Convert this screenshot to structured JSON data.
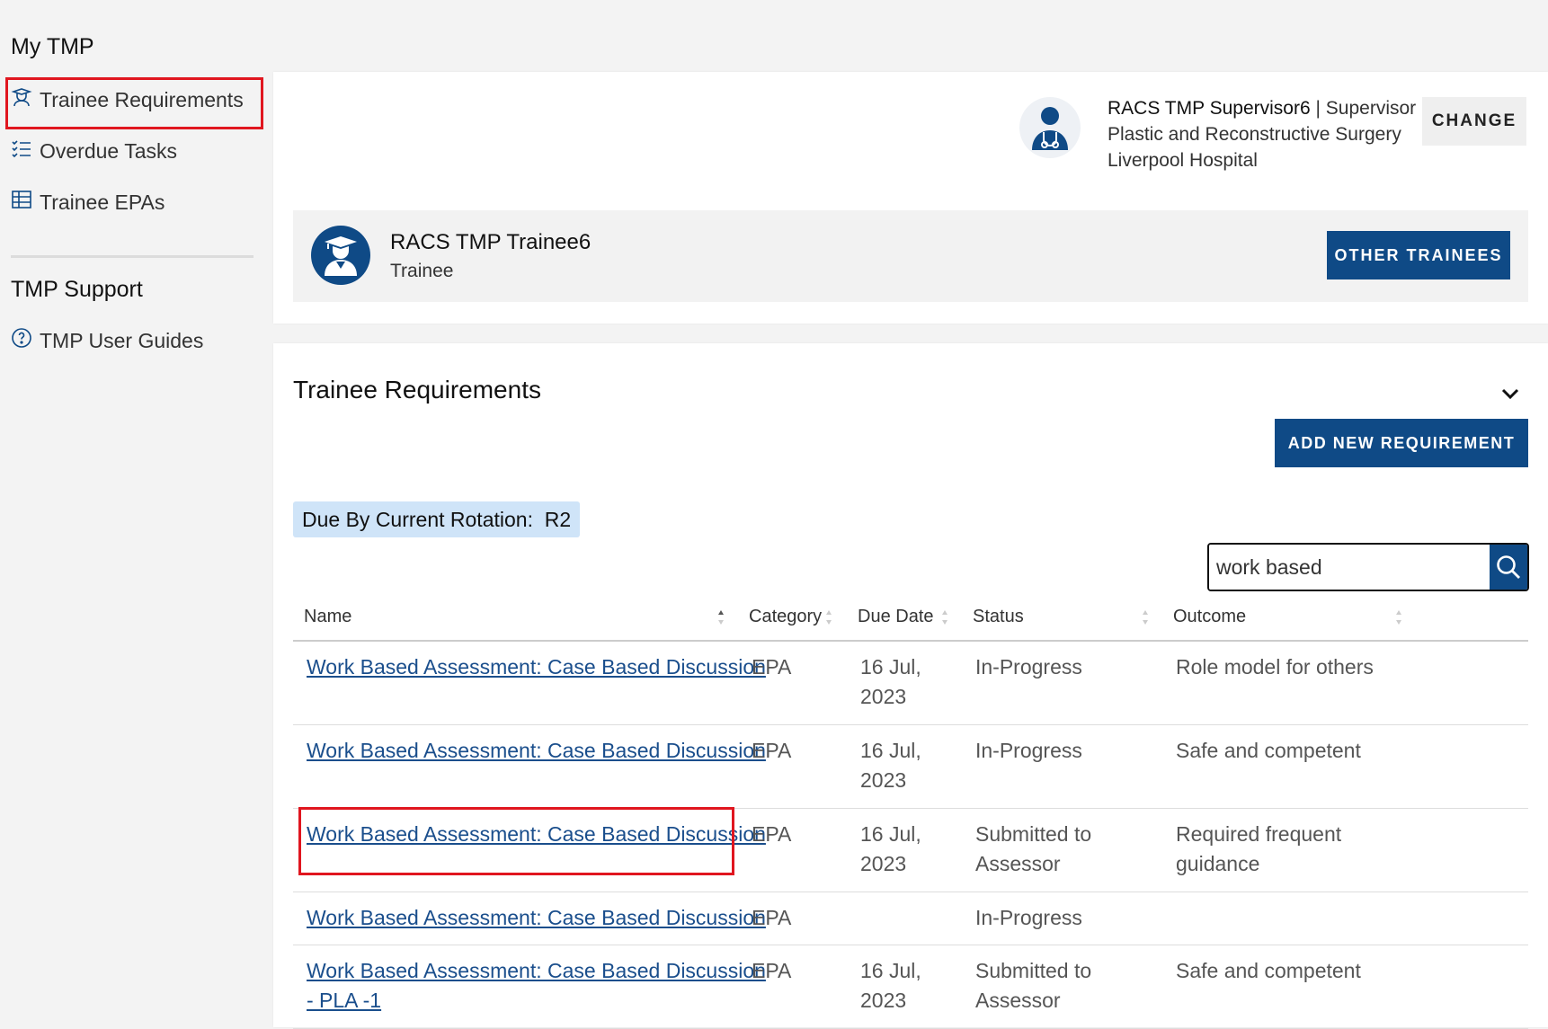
{
  "sidebar": {
    "section1_title": "My TMP",
    "items": [
      {
        "label": "Trainee Requirements",
        "icon": "mortarboard-person-icon"
      },
      {
        "label": "Overdue Tasks",
        "icon": "checklist-icon"
      },
      {
        "label": "Trainee EPAs",
        "icon": "table-icon"
      }
    ],
    "section2_title": "TMP Support",
    "support_items": [
      {
        "label": "TMP User Guides",
        "icon": "help-circle-icon"
      }
    ]
  },
  "supervisor": {
    "name": "RACS TMP Supervisor6",
    "separator": "|",
    "role": "Supervisor",
    "specialty": "Plastic and Reconstructive Surgery",
    "hospital": "Liverpool Hospital",
    "change_label": "CHANGE"
  },
  "trainee": {
    "name": "RACS TMP Trainee6",
    "role": "Trainee",
    "other_label": "OTHER TRAINEES"
  },
  "requirements": {
    "title": "Trainee Requirements",
    "add_label": "ADD NEW REQUIREMENT",
    "due_label": "Due By Current Rotation:",
    "due_value": "R2",
    "search_value": "work based",
    "columns": [
      "Name",
      "Category",
      "Due Date",
      "Status",
      "Outcome"
    ],
    "rows": [
      {
        "name": "Work Based Assessment: Case Based Discussion",
        "name2": "",
        "category": "EPA",
        "date1": "16 Jul,",
        "date2": "2023",
        "status1": "In-Progress",
        "status2": "",
        "outcome1": "Role model for others",
        "outcome2": ""
      },
      {
        "name": "Work Based Assessment: Case Based Discussion",
        "name2": "",
        "category": "EPA",
        "date1": "16 Jul,",
        "date2": "2023",
        "status1": "In-Progress",
        "status2": "",
        "outcome1": "Safe and competent",
        "outcome2": ""
      },
      {
        "name": "Work Based Assessment: Case Based Discussion",
        "name2": "",
        "category": "EPA",
        "date1": "16 Jul,",
        "date2": "2023",
        "status1": "Submitted to",
        "status2": "Assessor",
        "outcome1": "Required frequent",
        "outcome2": "guidance"
      },
      {
        "name": "Work Based Assessment: Case Based Discussion",
        "name2": "",
        "category": "EPA",
        "date1": "",
        "date2": "",
        "status1": "In-Progress",
        "status2": "",
        "outcome1": "",
        "outcome2": ""
      },
      {
        "name": "Work Based Assessment: Case Based Discussion",
        "name2": "- PLA -1",
        "category": "EPA",
        "date1": "16 Jul,",
        "date2": "2023",
        "status1": "Submitted to",
        "status2": "Assessor",
        "outcome1": "Safe and competent",
        "outcome2": ""
      }
    ]
  },
  "colors": {
    "primary": "#0f4a86",
    "link": "#1a4e8c",
    "badge": "#cfe4f8",
    "highlight": "#e0161f"
  }
}
